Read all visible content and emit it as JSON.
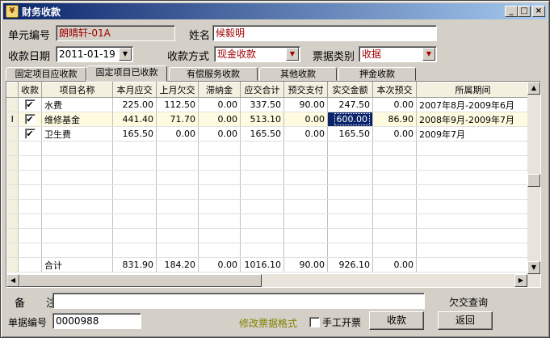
{
  "window": {
    "title": "财务收款",
    "controls": {
      "minimize": "_",
      "maximize": "□",
      "close": "×"
    }
  },
  "header": {
    "unit_label": "单元编号",
    "unit_value": "朗晴轩-01A",
    "name_label": "姓名",
    "name_value": "候毅明",
    "date_label": "收款日期",
    "date_value": "2011-01-19",
    "method_label": "收款方式",
    "method_value": "现金收款",
    "receipt_type_label": "票据类别",
    "receipt_type_value": "收据"
  },
  "tabs": [
    {
      "label": "固定项目应收款",
      "active": false
    },
    {
      "label": "固定项目已收款",
      "active": true
    },
    {
      "label": "有偿服务收款",
      "active": false
    },
    {
      "label": "其他收款",
      "active": false
    },
    {
      "label": "押金收款",
      "active": false
    }
  ],
  "table": {
    "columns": [
      "收款",
      "项目名称",
      "本月应交",
      "上月欠交",
      "滞纳金",
      "应交合计",
      "预交支付",
      "实交金额",
      "本次预交",
      "所属期间"
    ],
    "rows": [
      {
        "checked": "✔",
        "name": "水费",
        "cur": "225.00",
        "prev": "112.50",
        "late": "0.00",
        "total": "337.50",
        "prepay": "90.00",
        "paid": "247.50",
        "advance": "0.00",
        "period": "2007年8月-2009年6月",
        "indicator": ""
      },
      {
        "checked": "✔",
        "name": "维修基金",
        "cur": "441.40",
        "prev": "71.70",
        "late": "0.00",
        "total": "513.10",
        "prepay": "0.00",
        "paid": "600.00",
        "advance": "86.90",
        "period": "2008年9月-2009年7月",
        "indicator": "I"
      },
      {
        "checked": "✔",
        "name": "卫生费",
        "cur": "165.50",
        "prev": "0.00",
        "late": "0.00",
        "total": "165.50",
        "prepay": "0.00",
        "paid": "165.50",
        "advance": "0.00",
        "period": "2009年7月",
        "indicator": ""
      }
    ],
    "totals": {
      "label": "合计",
      "cur": "831.90",
      "prev": "184.20",
      "late": "0.00",
      "total": "1016.10",
      "prepay": "90.00",
      "paid": "926.10",
      "advance": "0.00"
    }
  },
  "footer": {
    "remark_label": "备　　注",
    "remark_value": "",
    "arrears_link": "欠交查询",
    "receipt_no_label": "单据编号",
    "receipt_no_value": "0000988",
    "modify_format": "修改票据格式",
    "manual_label": "手工开票",
    "collect_button": "收款",
    "back_button": "返回"
  },
  "colors": {
    "title_start": "#0a246a",
    "title_end": "#a6caf0",
    "selection": "#0a246a",
    "text_red": "#a00000",
    "link_olive": "#808000"
  }
}
